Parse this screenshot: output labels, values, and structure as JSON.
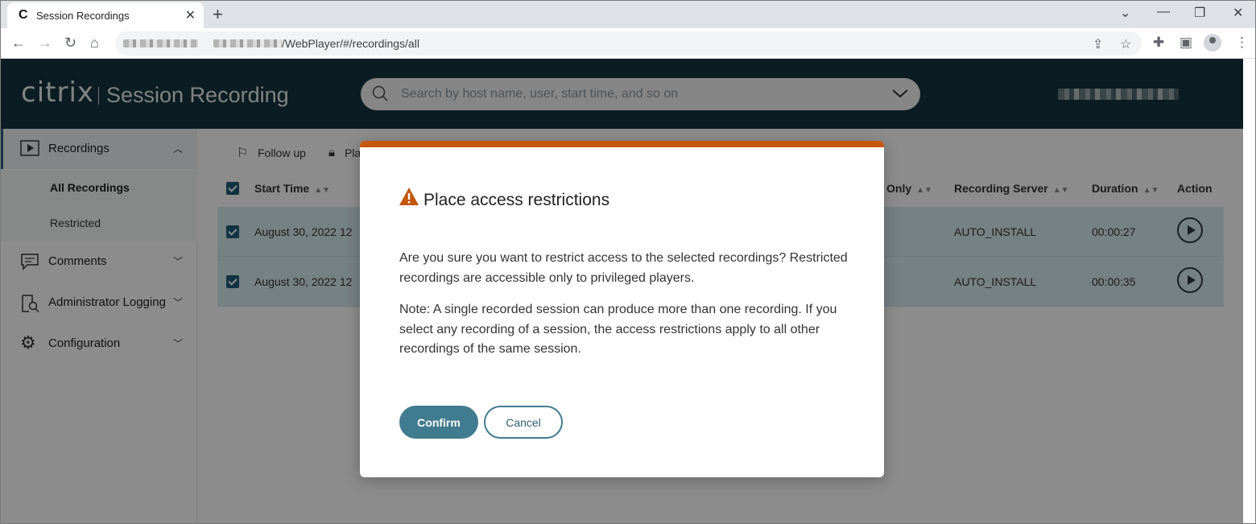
{
  "browser": {
    "tab_title": "Session Recordings",
    "tab_favicon": "C",
    "url_path": "/WebPlayer/#/recordings/all"
  },
  "header": {
    "logo": "citrix",
    "product": "Session Recording",
    "search_placeholder": "Search by host name, user, start time, and so on"
  },
  "sidebar": {
    "recordings": "Recordings",
    "all_recordings": "All Recordings",
    "restricted": "Restricted",
    "comments": "Comments",
    "admin_logging": "Administrator Logging",
    "configuration": "Configuration"
  },
  "actions": {
    "follow_up": "Follow up",
    "place_partial": "Pla"
  },
  "table": {
    "columns": {
      "start_time": "Start Time",
      "only_partial": "Only",
      "recording_server": "Recording Server",
      "duration": "Duration",
      "action": "Action"
    },
    "rows": [
      {
        "start_time": "August 30, 2022 12",
        "recording_server": "AUTO_INSTALL",
        "duration": "00:00:27"
      },
      {
        "start_time": "August 30, 2022 12",
        "recording_server": "AUTO_INSTALL",
        "duration": "00:00:35"
      }
    ]
  },
  "modal": {
    "title": "Place access restrictions",
    "p1": "Are you sure you want to restrict access to the selected recordings? Restricted recordings are accessible only to privileged players.",
    "p2": "Note: A single recorded session can produce more than one recording. If you select any recording of a session, the access restrictions apply to all other recordings of the same session.",
    "confirm": "Confirm",
    "cancel": "Cancel"
  },
  "colors": {
    "header_bg": "#15333f",
    "accent": "#c4570c",
    "primary_button": "#417b8f",
    "row_selected": "#d8ebee"
  }
}
